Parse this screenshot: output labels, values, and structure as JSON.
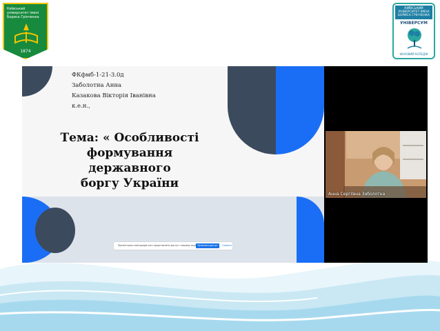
{
  "left_logo": {
    "text": "Київський університет імені Бориса Грінченка",
    "year": "1874"
  },
  "right_logo": {
    "top_text": "КИЇВСЬКИЙ УНІВЕРСИТЕТ ІМЕНІ БОРИСА ГРІНЧЕНКА",
    "brand": "УНІВЕРСУМ",
    "footer": "ФАХОВИЙ КОЛЕДЖ"
  },
  "slide": {
    "meta_lines": [
      "ФКфмб-1-21-3.0д",
      "Заболотна Анна",
      "Казакова Вікторія Іванівна",
      "к.е.н.,"
    ],
    "title_lines": [
      "Тема: « Особливості",
      "формування державного",
      "боргу України"
    ]
  },
  "notice": {
    "text": "Презентацію meet.google.com представлено доступ з вашему екрані.",
    "button": "Зупинити доступ",
    "close": "Сховати"
  },
  "video": {
    "participant_name": "Анна Сергіївна Заболотна"
  },
  "colors": {
    "accent_blue": "#1a6ef5",
    "dark_slate": "#3c4a5e",
    "band": "#dde3ea"
  }
}
